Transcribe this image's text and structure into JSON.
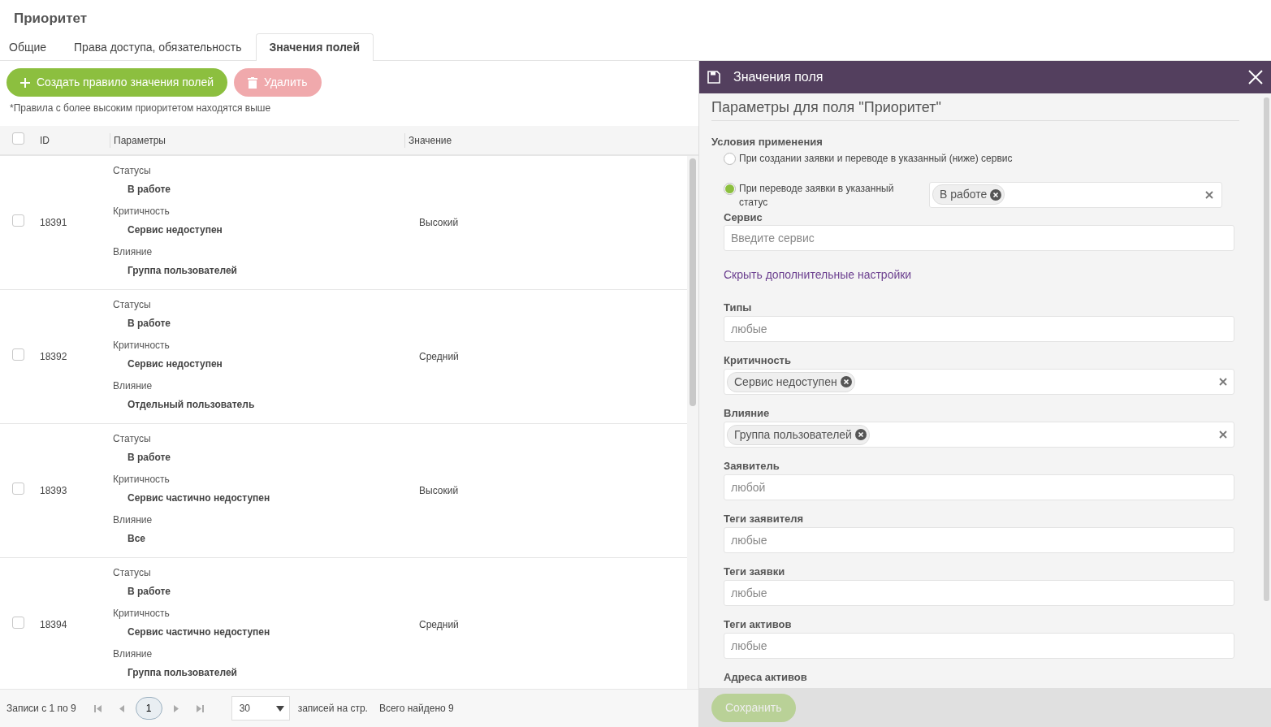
{
  "page_title": "Приоритет",
  "tabs": [
    {
      "label": "Общие",
      "selected": false
    },
    {
      "label": "Права доступа, обязательность",
      "selected": false
    },
    {
      "label": "Значения полей",
      "selected": true
    }
  ],
  "toolbar": {
    "create_button": {
      "label": "Создать правило значения полей",
      "disabled": false
    },
    "delete_button": {
      "label": "Удалить",
      "disabled": true
    }
  },
  "note": "*Правила с более высоким приоритетом находятся выше",
  "table": {
    "select_all_checked": false,
    "columns": [
      "ID",
      "Параметры",
      "Значение"
    ],
    "rows": [
      {
        "checked": false,
        "id": "18391",
        "params": [
          {
            "label": "Статусы",
            "value": "В работе"
          },
          {
            "label": "Критичность",
            "value": "Сервис недоступен"
          },
          {
            "label": "Влияние",
            "value": "Группа пользователей"
          }
        ],
        "value": "Высокий"
      },
      {
        "checked": false,
        "id": "18392",
        "params": [
          {
            "label": "Статусы",
            "value": "В работе"
          },
          {
            "label": "Критичность",
            "value": "Сервис недоступен"
          },
          {
            "label": "Влияние",
            "value": "Отдельный пользователь"
          }
        ],
        "value": "Средний"
      },
      {
        "checked": false,
        "id": "18393",
        "params": [
          {
            "label": "Статусы",
            "value": "В работе"
          },
          {
            "label": "Критичность",
            "value": "Сервис частично недоступен"
          },
          {
            "label": "Влияние",
            "value": "Все"
          }
        ],
        "value": "Высокий"
      },
      {
        "checked": false,
        "id": "18394",
        "params": [
          {
            "label": "Статусы",
            "value": "В работе"
          },
          {
            "label": "Критичность",
            "value": "Сервис частично недоступен"
          },
          {
            "label": "Влияние",
            "value": "Группа пользователей"
          }
        ],
        "value": "Средний"
      }
    ]
  },
  "pager": {
    "range": "Записи с 1 по 9",
    "pages": [
      {
        "label": "1",
        "selected": true
      }
    ],
    "page_size": "30",
    "page_size_label": "записей на стр.",
    "total": "Всего найдено 9"
  },
  "panel": {
    "title": "Значения поля",
    "heading": "Параметры для поля \"Приоритет\"",
    "conditions_label": "Условия применения",
    "radios": [
      {
        "label": "При создании заявки и переводе в указанный (ниже) сервис",
        "selected": false
      },
      {
        "label": "При переводе заявки в указанный статус",
        "selected": true,
        "tags": [
          "В работе"
        ]
      }
    ],
    "service": {
      "label": "Сервис",
      "placeholder": "Введите сервис"
    },
    "toggle_link": "Скрыть дополнительные настройки",
    "fields": [
      {
        "label": "Типы",
        "placeholder": "любые"
      },
      {
        "label": "Критичность",
        "tags": [
          "Сервис недоступен"
        ]
      },
      {
        "label": "Влияние",
        "tags": [
          "Группа пользователей"
        ]
      },
      {
        "label": "Заявитель",
        "placeholder": "любой"
      },
      {
        "label": "Теги заявителя",
        "placeholder": "любые"
      },
      {
        "label": "Теги заявки",
        "placeholder": "любые"
      },
      {
        "label": "Теги активов",
        "placeholder": "любые"
      },
      {
        "label": "Адреса активов"
      }
    ],
    "save_button": {
      "label": "Сохранить",
      "disabled": true
    }
  }
}
